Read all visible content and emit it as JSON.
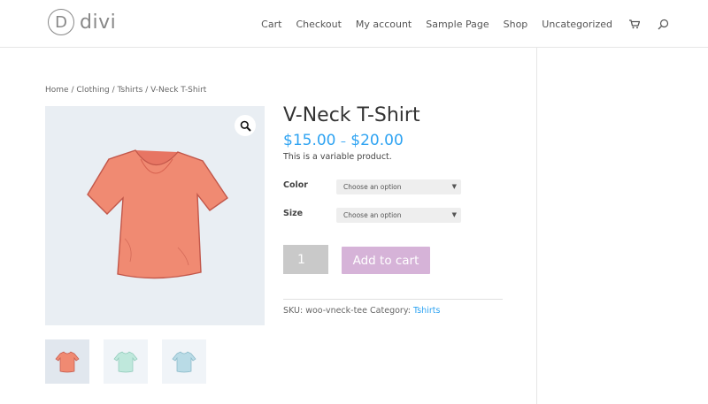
{
  "header": {
    "logo_letter": "D",
    "logo_text": "divi",
    "nav": [
      "Cart",
      "Checkout",
      "My account",
      "Sample Page",
      "Shop",
      "Uncategorized"
    ],
    "icons": [
      "cart-icon",
      "search-icon"
    ]
  },
  "breadcrumb": "Home / Clothing / Tshirts / V-Neck T-Shirt",
  "product": {
    "title": "V-Neck T-Shirt",
    "price_low": "$15.00",
    "price_sep": "–",
    "price_high": "$20.00",
    "short_description": "This is a variable product.",
    "attributes": [
      {
        "label": "Color",
        "select_value": "Choose an option"
      },
      {
        "label": "Size",
        "select_value": "Choose an option"
      }
    ],
    "quantity": "1",
    "add_to_cart_label": "Add to cart",
    "sku_label": "SKU:",
    "sku_value": "woo-vneck-tee",
    "category_label": "Category:",
    "category_value": "Tshirts"
  },
  "colors": {
    "accent": "#2ea3f2",
    "add_to_cart_bg": "#d6b3d8",
    "shirt_red": "#f08a72",
    "shirt_green": "#bfe8dc",
    "shirt_blue": "#b9dbe6"
  }
}
